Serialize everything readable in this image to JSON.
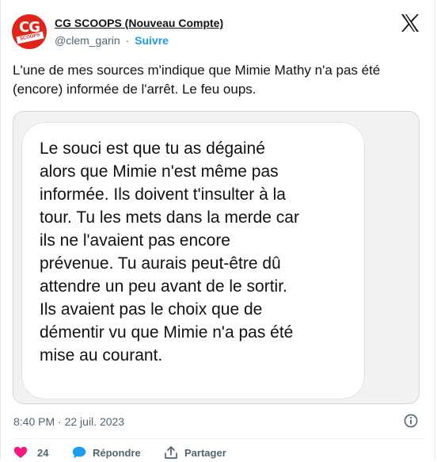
{
  "author": {
    "display_name": "CG SCOOPS (Nouveau Compte)",
    "handle": "@clem_garin",
    "separator": "·",
    "follow_label": "Suivre",
    "avatar_text_main": "CG",
    "avatar_text_band": "SCOOPS",
    "brand_color": "#e2231a"
  },
  "tweet": {
    "text": "L'une de mes sources m'indique que Mimie Mathy n'a pas été (encore) informée de l'arrêt. Le feu oups.",
    "image_message": "Le souci est que tu as dégainé\nalors que Mimie n'est même pas\ninformée. Ils doivent t'insulter à la\ntour. Tu les mets dans la merde car\nils ne l'avaient pas encore\nprévenue. Tu aurais peut-être dû\nattendre un peu avant de le sortir.\nIls avaient pas le choix que de\ndémentir vu que Mimie n'a pas été\nmise au courant.",
    "timestamp": "8:40 PM · 22 juil. 2023"
  },
  "actions": {
    "like_count": "24",
    "reply_label": "Répondre",
    "share_label": "Partager"
  },
  "icons": {
    "logo": "x-logo-icon",
    "info": "info-icon",
    "like": "heart-icon",
    "reply": "speech-bubble-icon",
    "share": "share-icon"
  },
  "colors": {
    "accent": "#1d9bf0",
    "like": "#f91880",
    "muted": "#536471"
  }
}
